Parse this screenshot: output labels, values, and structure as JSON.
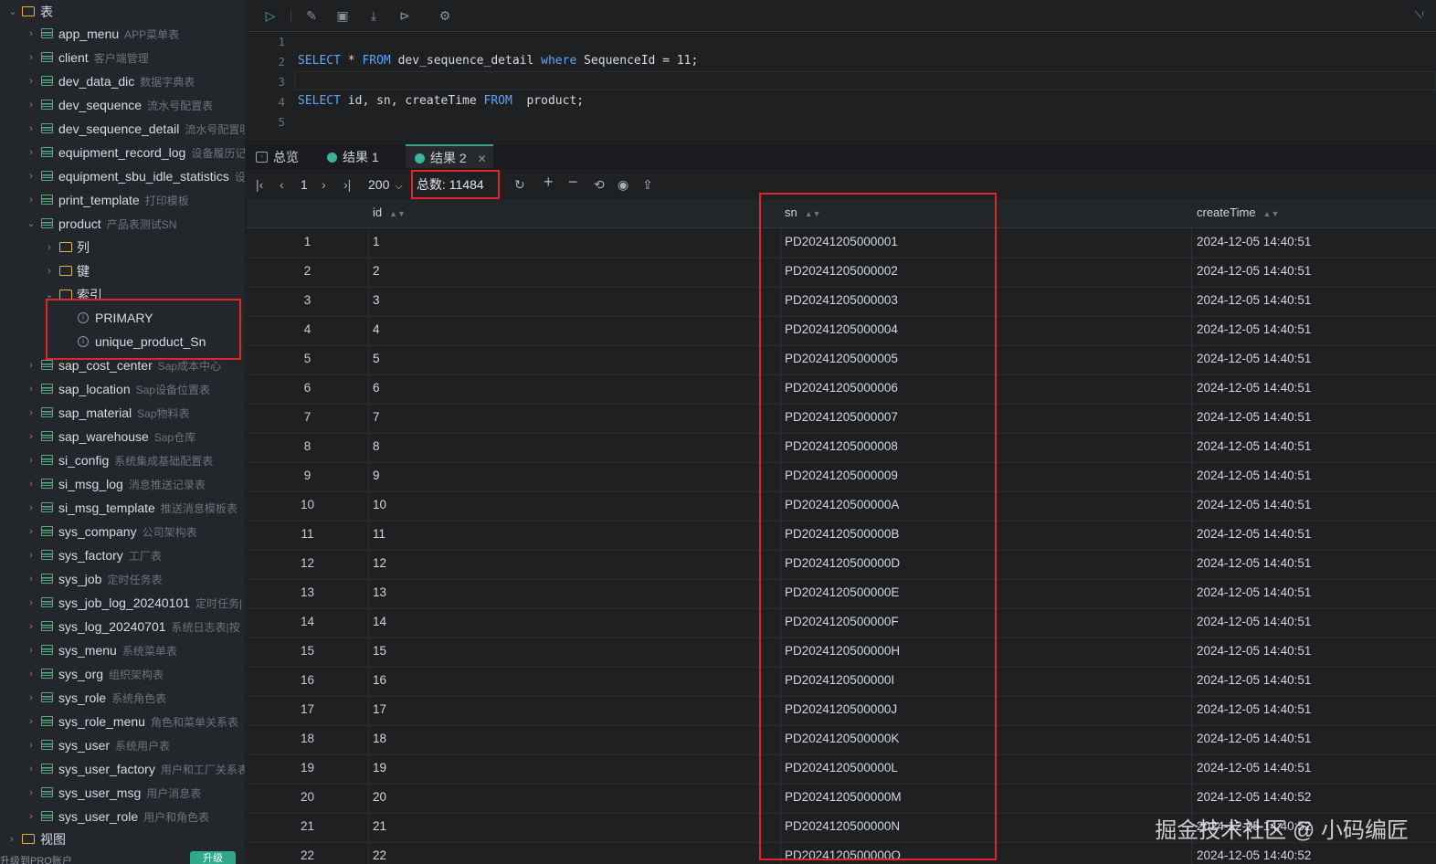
{
  "sidebar": {
    "root": {
      "label": "表"
    },
    "tables": [
      {
        "name": "app_menu",
        "comment": "APP菜单表"
      },
      {
        "name": "client",
        "comment": "客户端管理"
      },
      {
        "name": "dev_data_dic",
        "comment": "数据字典表"
      },
      {
        "name": "dev_sequence",
        "comment": "流水号配置表"
      },
      {
        "name": "dev_sequence_detail",
        "comment": "流水号配置明"
      },
      {
        "name": "equipment_record_log",
        "comment": "设备履历记"
      },
      {
        "name": "equipment_sbu_idle_statistics",
        "comment": "设"
      },
      {
        "name": "print_template",
        "comment": "打印模板"
      },
      {
        "name": "product",
        "comment": "产品表测试SN"
      }
    ],
    "product_children": [
      {
        "label": "列"
      },
      {
        "label": "键"
      },
      {
        "label": "索引"
      }
    ],
    "indexes": [
      {
        "label": "PRIMARY"
      },
      {
        "label": "unique_product_Sn"
      }
    ],
    "tables_after": [
      {
        "name": "sap_cost_center",
        "comment": "Sap成本中心"
      },
      {
        "name": "sap_location",
        "comment": "Sap设备位置表"
      },
      {
        "name": "sap_material",
        "comment": "Sap物料表"
      },
      {
        "name": "sap_warehouse",
        "comment": "Sap仓库"
      },
      {
        "name": "si_config",
        "comment": "系统集成基础配置表"
      },
      {
        "name": "si_msg_log",
        "comment": "消息推送记录表"
      },
      {
        "name": "si_msg_template",
        "comment": "推送消息模板表"
      },
      {
        "name": "sys_company",
        "comment": "公司架构表"
      },
      {
        "name": "sys_factory",
        "comment": "工厂表"
      },
      {
        "name": "sys_job",
        "comment": "定时任务表"
      },
      {
        "name": "sys_job_log_20240101",
        "comment": "定时任务|"
      },
      {
        "name": "sys_log_20240701",
        "comment": "系统日志表|按"
      },
      {
        "name": "sys_menu",
        "comment": "系统菜单表"
      },
      {
        "name": "sys_org",
        "comment": "组织架构表"
      },
      {
        "name": "sys_role",
        "comment": "系统角色表"
      },
      {
        "name": "sys_role_menu",
        "comment": "角色和菜单关系表"
      },
      {
        "name": "sys_user",
        "comment": "系统用户表"
      },
      {
        "name": "sys_user_factory",
        "comment": "用户和工厂关系表"
      },
      {
        "name": "sys_user_msg",
        "comment": "用户消息表"
      },
      {
        "name": "sys_user_role",
        "comment": "用户和角色表"
      }
    ],
    "views": {
      "label": "视图"
    },
    "bottom_left": "升级到PRO账户",
    "bottom_button": "升级"
  },
  "editor": {
    "lines": [
      "1",
      "2",
      "3",
      "4",
      "5"
    ],
    "sql1": {
      "k1": "SELECT",
      "a": " * ",
      "k2": "FROM",
      "b": " dev_sequence_detail ",
      "k3": "where",
      "c": " SequenceId = 11;"
    },
    "sql2": {
      "k1": "SELECT",
      "a": " id, sn, createTime ",
      "k2": "FROM",
      "b": "  product;"
    }
  },
  "result_tabs": [
    {
      "label": "总览"
    },
    {
      "label": "结果 1"
    },
    {
      "label": "结果 2"
    }
  ],
  "pager": {
    "page": "1",
    "page_size": "200",
    "total_label": "总数:",
    "total_value": "11484"
  },
  "grid": {
    "columns": [
      "id",
      "sn",
      "createTime"
    ],
    "rows": [
      [
        "1",
        "1",
        "PD20241205000001",
        "2024-12-05 14:40:51"
      ],
      [
        "2",
        "2",
        "PD20241205000002",
        "2024-12-05 14:40:51"
      ],
      [
        "3",
        "3",
        "PD20241205000003",
        "2024-12-05 14:40:51"
      ],
      [
        "4",
        "4",
        "PD20241205000004",
        "2024-12-05 14:40:51"
      ],
      [
        "5",
        "5",
        "PD20241205000005",
        "2024-12-05 14:40:51"
      ],
      [
        "6",
        "6",
        "PD20241205000006",
        "2024-12-05 14:40:51"
      ],
      [
        "7",
        "7",
        "PD20241205000007",
        "2024-12-05 14:40:51"
      ],
      [
        "8",
        "8",
        "PD20241205000008",
        "2024-12-05 14:40:51"
      ],
      [
        "9",
        "9",
        "PD20241205000009",
        "2024-12-05 14:40:51"
      ],
      [
        "10",
        "10",
        "PD2024120500000A",
        "2024-12-05 14:40:51"
      ],
      [
        "11",
        "11",
        "PD2024120500000B",
        "2024-12-05 14:40:51"
      ],
      [
        "12",
        "12",
        "PD2024120500000D",
        "2024-12-05 14:40:51"
      ],
      [
        "13",
        "13",
        "PD2024120500000E",
        "2024-12-05 14:40:51"
      ],
      [
        "14",
        "14",
        "PD2024120500000F",
        "2024-12-05 14:40:51"
      ],
      [
        "15",
        "15",
        "PD2024120500000H",
        "2024-12-05 14:40:51"
      ],
      [
        "16",
        "16",
        "PD2024120500000I",
        "2024-12-05 14:40:51"
      ],
      [
        "17",
        "17",
        "PD2024120500000J",
        "2024-12-05 14:40:51"
      ],
      [
        "18",
        "18",
        "PD2024120500000K",
        "2024-12-05 14:40:51"
      ],
      [
        "19",
        "19",
        "PD2024120500000L",
        "2024-12-05 14:40:51"
      ],
      [
        "20",
        "20",
        "PD2024120500000M",
        "2024-12-05 14:40:52"
      ],
      [
        "21",
        "21",
        "PD2024120500000N",
        "2024-12-05 14:40:52"
      ],
      [
        "22",
        "22",
        "PD2024120500000O",
        "2024-12-05 14:40:52"
      ]
    ]
  },
  "watermark": "掘金技术社区 @ 小码编匠",
  "colors": {
    "accent": "#3db39e",
    "highlight": "#e0262a",
    "keyword": "#5aa5ff"
  }
}
